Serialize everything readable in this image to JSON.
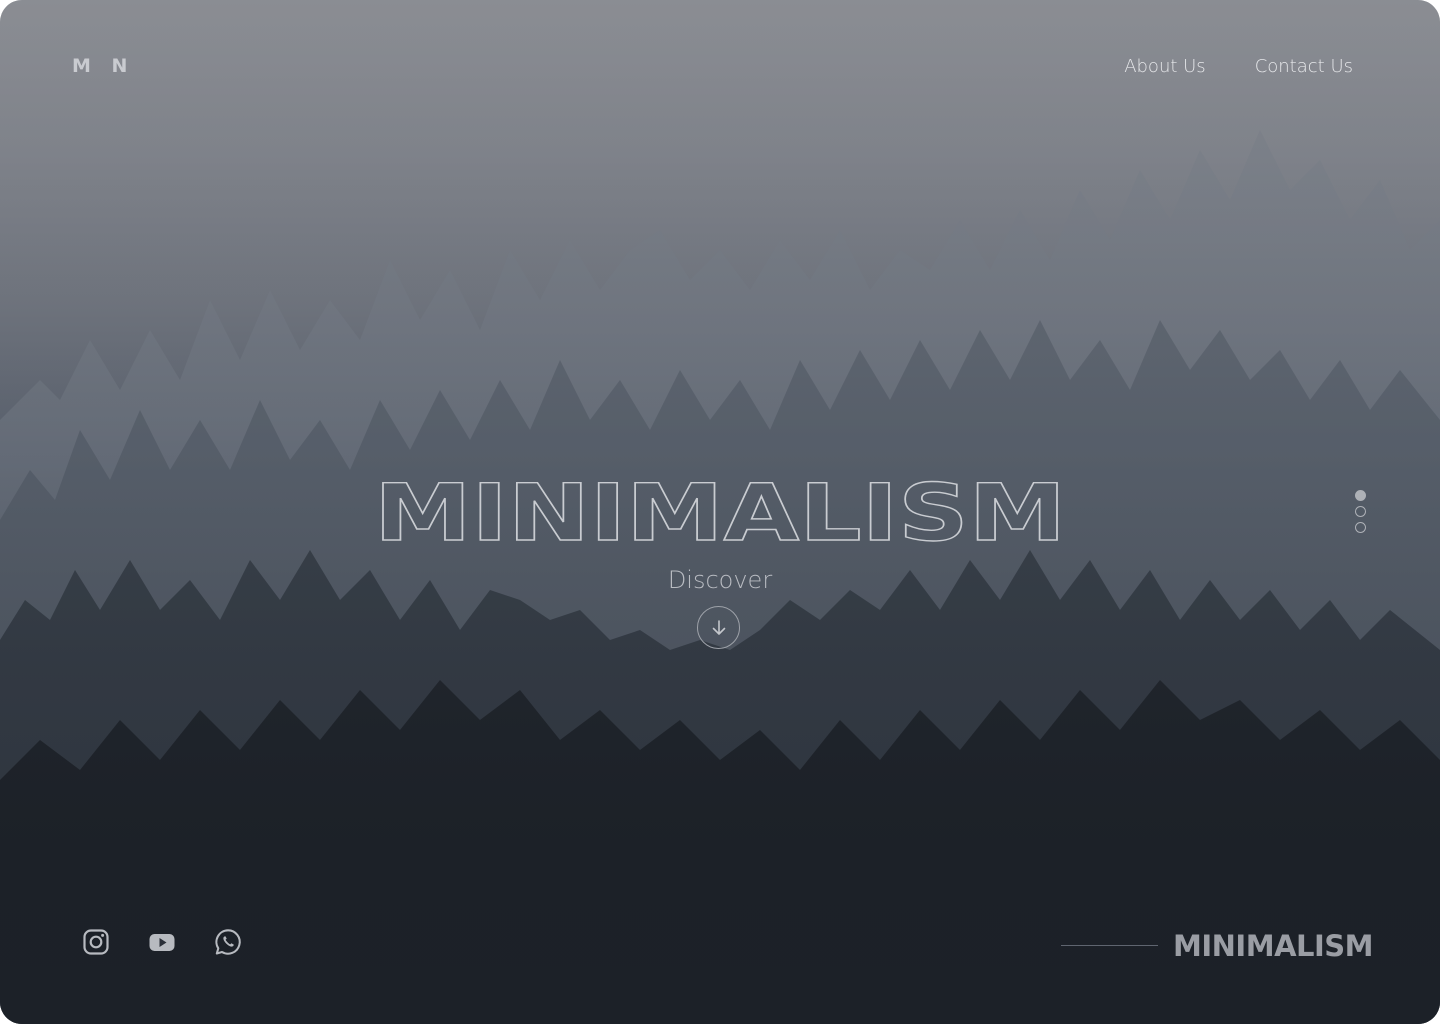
{
  "header": {
    "logo": "M N",
    "nav": [
      {
        "label": "About Us"
      },
      {
        "label": "Contact Us"
      }
    ]
  },
  "hero": {
    "title": "MINIMALISM",
    "discover_label": "Discover",
    "discover_icon": "arrow-down-icon"
  },
  "pagination": {
    "total": 3,
    "active_index": 0
  },
  "social": {
    "icons": [
      "instagram-icon",
      "youtube-icon",
      "whatsapp-icon"
    ]
  },
  "footer": {
    "brand": "MINIMALISM"
  },
  "colors": {
    "text_light": "#e6e7ea",
    "muted": "#9a9da4"
  }
}
